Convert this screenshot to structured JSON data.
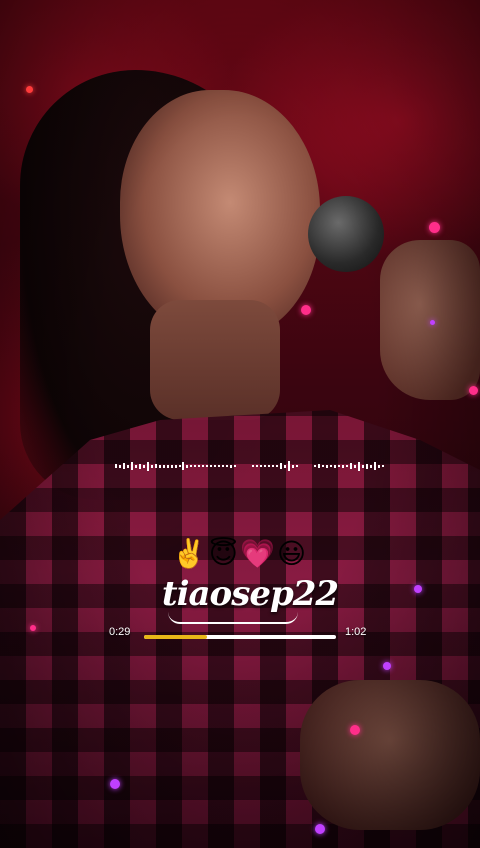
{
  "player": {
    "signature": "tiaosep22",
    "current_time": "0:29",
    "total_time": "1:02",
    "progress": 0.33,
    "progress_color": "#e8b818"
  },
  "emojis": [
    {
      "name": "victory-hand-icon",
      "char": "✌️"
    },
    {
      "name": "smiling-face-with-halo-icon",
      "char": "😇"
    },
    {
      "name": "heart-icon",
      "char": "💗"
    },
    {
      "name": "smiley-face-icon",
      "char": "😃"
    }
  ],
  "background": {
    "description_colors": [
      "#6e0715",
      "#8e1d45",
      "#1a0408"
    ],
    "sparkle_colors": [
      "#ff2e8a",
      "#ff3b3b",
      "#c040ff"
    ]
  }
}
